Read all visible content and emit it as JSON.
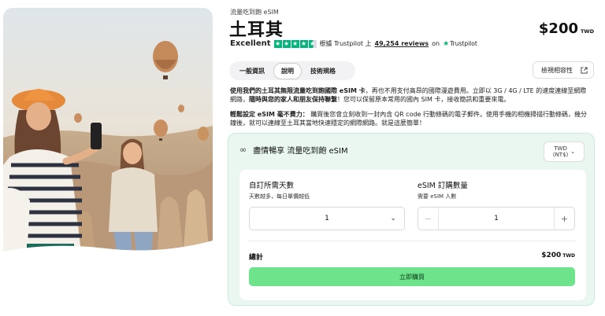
{
  "breadcrumb": "流量吃到飽 eSIM",
  "title": "土耳其",
  "price": {
    "amount": "$200",
    "currency": "TWD"
  },
  "rating": {
    "label": "Excellent",
    "stars": 4.5,
    "based_on": "根據 Trustpilot 上",
    "reviews": "49,254 reviews",
    "on": "on",
    "brand": "Trustpilot"
  },
  "tabs": [
    {
      "label": "一般資訊",
      "active": false
    },
    {
      "label": "說明",
      "active": true
    },
    {
      "label": "技術規格",
      "active": false
    }
  ],
  "compat_button": "檢視相容性",
  "description": {
    "p1_bold1": "使用我們的土耳其無限流量吃到飽國際 eSIM 卡",
    "p1_text1": "，再也不用支付高昂的國際漫遊費用。立即以 3G / 4G / LTE 的速度連線至網際網路，",
    "p1_bold2": "隨時與您的家人和朋友保持聯繫",
    "p1_text2": "！您可以保留原本常用的國內 SIM 卡，接收簡訊和重要來電。",
    "p2_bold": "輕鬆設定 eSIM 毫不費力：",
    "p2_text": " 購買後您會立刻收到一封內含 QR code 行動條碼的電子郵件。使用手機的相機掃描行動條碼，幾分鐘後，就可以連線至土耳其當地快速穩定的網際網路。就是這麼簡單！"
  },
  "card": {
    "title": "盡情暢享 流量吃到飽 eSIM",
    "currency_select": {
      "line1": "TWD",
      "line2": "(NT$)"
    },
    "days": {
      "label": "自訂所需天數",
      "sub": "天數越多，每日單價越低",
      "value": "1"
    },
    "quantity": {
      "label": "eSIM 訂購數量",
      "sub": "需要 eSIM 人數",
      "value": "1"
    },
    "total_label": "總計",
    "total": {
      "amount": "$200",
      "currency": "TWD"
    },
    "buy_button": "立即購買"
  },
  "colors": {
    "accent_green": "#6fe38b",
    "card_bg": "#e9f7f0",
    "trustpilot_green": "#00b67a"
  },
  "icons": [
    "infinity-icon",
    "chevron-down-icon",
    "minus-icon",
    "plus-icon",
    "external-link-icon",
    "star-icon"
  ]
}
